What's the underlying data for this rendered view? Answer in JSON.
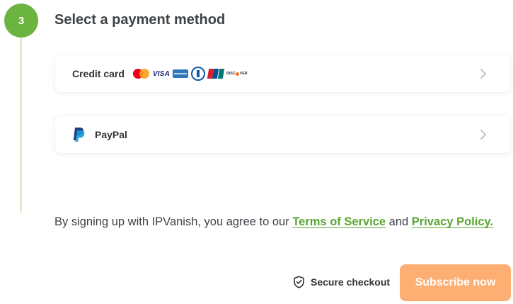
{
  "step": {
    "number": "3",
    "title": "Select a payment method",
    "accent_color": "#6bb43f"
  },
  "payment_methods": [
    {
      "label": "Credit card",
      "logos": [
        "mastercard-icon",
        "visa-icon",
        "amex-icon",
        "diners-club-icon",
        "unionpay-icon",
        "discover-icon"
      ],
      "visa_text": "VISA",
      "discover_text_a": "DISC",
      "discover_text_b": "VER"
    },
    {
      "label": "PayPal",
      "logos": [
        "paypal-icon"
      ]
    }
  ],
  "terms": {
    "prefix": "By signing up with IPVanish, you agree to our ",
    "tos_link": "Terms of Service",
    "middle": " and ",
    "privacy_link": "Privacy Policy."
  },
  "footer": {
    "secure_label": "Secure checkout",
    "subscribe_label": "Subscribe now",
    "subscribe_color": "#fdae72",
    "link_color": "#5aa632"
  }
}
